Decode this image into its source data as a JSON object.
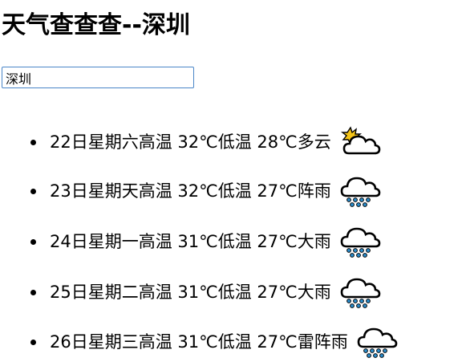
{
  "page": {
    "title": "天气查查查--深圳"
  },
  "search": {
    "value": "深圳"
  },
  "forecast": [
    {
      "date": "22日星期六",
      "high": "高温 32℃",
      "low": "低温 28℃",
      "weather": "多云",
      "icon": "partly-cloudy-icon"
    },
    {
      "date": "23日星期天",
      "high": "高温 32℃",
      "low": "低温 27℃",
      "weather": "阵雨",
      "icon": "rain-icon"
    },
    {
      "date": "24日星期一",
      "high": "高温 31℃",
      "low": "低温 27℃",
      "weather": "大雨",
      "icon": "rain-icon"
    },
    {
      "date": "25日星期二",
      "high": "高温 31℃",
      "low": "低温 27℃",
      "weather": "大雨",
      "icon": "rain-icon"
    },
    {
      "date": "26日星期三",
      "high": "高温 31℃",
      "low": "低温 27℃",
      "weather": "雷阵雨",
      "icon": "rain-icon"
    }
  ]
}
